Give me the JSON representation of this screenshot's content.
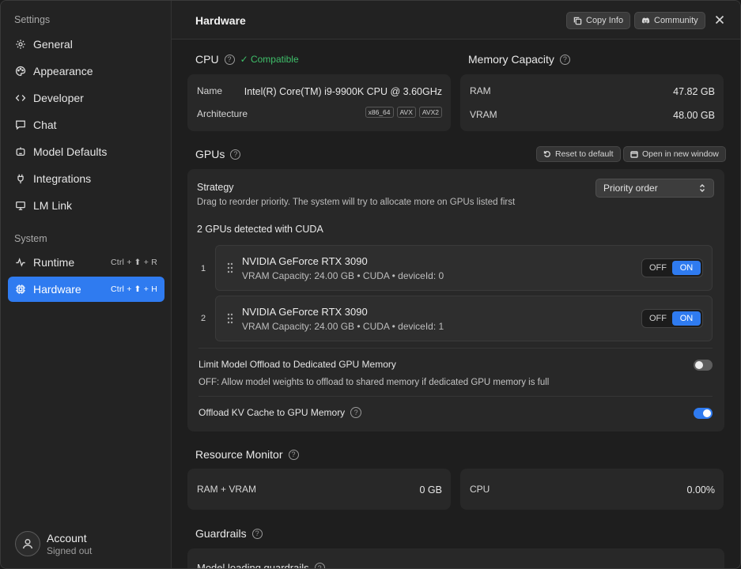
{
  "sidebar": {
    "settings_heading": "Settings",
    "system_heading": "System",
    "items": [
      {
        "label": "General",
        "icon": "gear-icon"
      },
      {
        "label": "Appearance",
        "icon": "palette-icon"
      },
      {
        "label": "Developer",
        "icon": "code-icon"
      },
      {
        "label": "Chat",
        "icon": "chat-icon"
      },
      {
        "label": "Model Defaults",
        "icon": "model-icon"
      },
      {
        "label": "Integrations",
        "icon": "plug-icon"
      },
      {
        "label": "LM Link",
        "icon": "link-icon"
      }
    ],
    "system_items": [
      {
        "label": "Runtime",
        "icon": "pulse-icon",
        "shortcut": "Ctrl + ⬆ + R"
      },
      {
        "label": "Hardware",
        "icon": "chip-icon",
        "shortcut": "Ctrl + ⬆ + H",
        "active": true
      }
    ],
    "account": {
      "name": "Account",
      "status": "Signed out"
    }
  },
  "header": {
    "title": "Hardware",
    "copy_info": "Copy Info",
    "community": "Community"
  },
  "cpu": {
    "title": "CPU",
    "compat": "✓ Compatible",
    "name_label": "Name",
    "name_value": "Intel(R) Core(TM) i9-9900K CPU @ 3.60GHz",
    "arch_label": "Architecture",
    "arch_chips": [
      "x86_64",
      "AVX",
      "AVX2"
    ]
  },
  "memory": {
    "title": "Memory Capacity",
    "ram_label": "RAM",
    "ram_value": "47.82 GB",
    "vram_label": "VRAM",
    "vram_value": "48.00 GB"
  },
  "gpus": {
    "title": "GPUs",
    "reset": "Reset to default",
    "open_window": "Open in new window",
    "strategy_label": "Strategy",
    "strategy_desc": "Drag to reorder priority. The system will try to allocate more on GPUs listed first",
    "strategy_value": "Priority order",
    "detected": "2 GPUs detected with CUDA",
    "list": [
      {
        "index": "1",
        "name": "NVIDIA GeForce RTX 3090",
        "sub": "VRAM Capacity: 24.00 GB • CUDA • deviceId: 0",
        "off": "OFF",
        "on": "ON"
      },
      {
        "index": "2",
        "name": "NVIDIA GeForce RTX 3090",
        "sub": "VRAM Capacity: 24.00 GB • CUDA • deviceId: 1",
        "off": "OFF",
        "on": "ON"
      }
    ],
    "limit_offload_label": "Limit Model Offload to Dedicated GPU Memory",
    "limit_offload_desc": "OFF: Allow model weights to offload to shared memory if dedicated GPU memory is full",
    "limit_offload_enabled": false,
    "kv_cache_label": "Offload KV Cache to GPU Memory",
    "kv_cache_enabled": true
  },
  "resource": {
    "title": "Resource Monitor",
    "ramvram_label": "RAM + VRAM",
    "ramvram_value": "0 GB",
    "cpu_label": "CPU",
    "cpu_value": "0.00%"
  },
  "guardrails": {
    "title": "Guardrails",
    "model_loading": "Model loading guardrails"
  },
  "colors": {
    "accent": "#2f7bf0",
    "compatible": "#3fbf6a"
  }
}
